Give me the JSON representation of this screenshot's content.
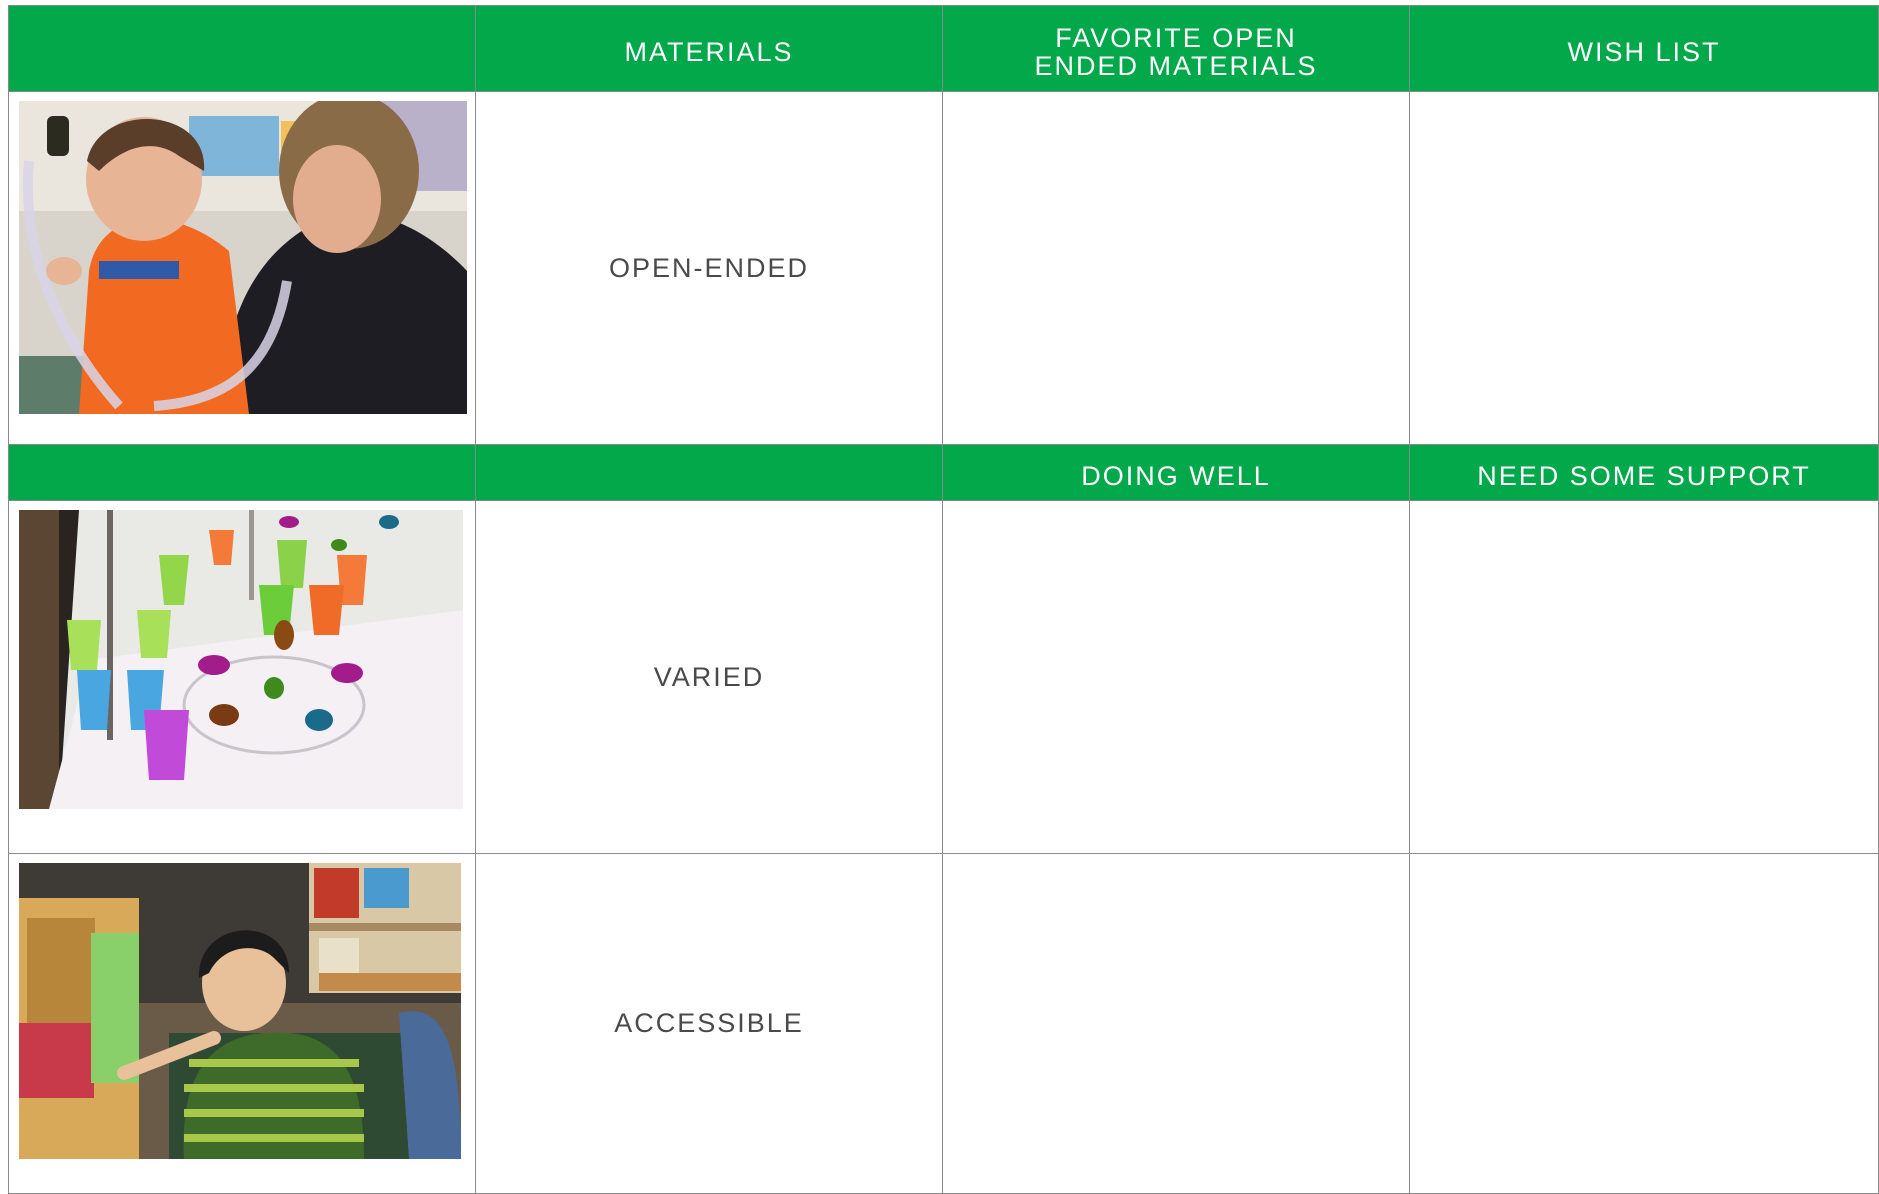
{
  "header_row_1": {
    "col_1": "",
    "col_2": "MATERIALS",
    "col_3": "FAVORITE OPEN ENDED MATERIALS",
    "col_4": "WISH LIST"
  },
  "header_row_2": {
    "col_1": "",
    "col_2": "",
    "col_3": "DOING WELL",
    "col_4": "NEED SOME SUPPORT"
  },
  "rows": [
    {
      "label": "OPEN-ENDED",
      "col_3": "",
      "col_4": ""
    },
    {
      "label": "VARIED",
      "col_3": "",
      "col_4": ""
    },
    {
      "label": "ACCESSIBLE",
      "col_3": "",
      "col_4": ""
    }
  ],
  "colors": {
    "header_green": "#03a84b",
    "header_text": "#ffffff",
    "label_text": "#4a4a4a",
    "grid_line": "#8a8a8a"
  }
}
